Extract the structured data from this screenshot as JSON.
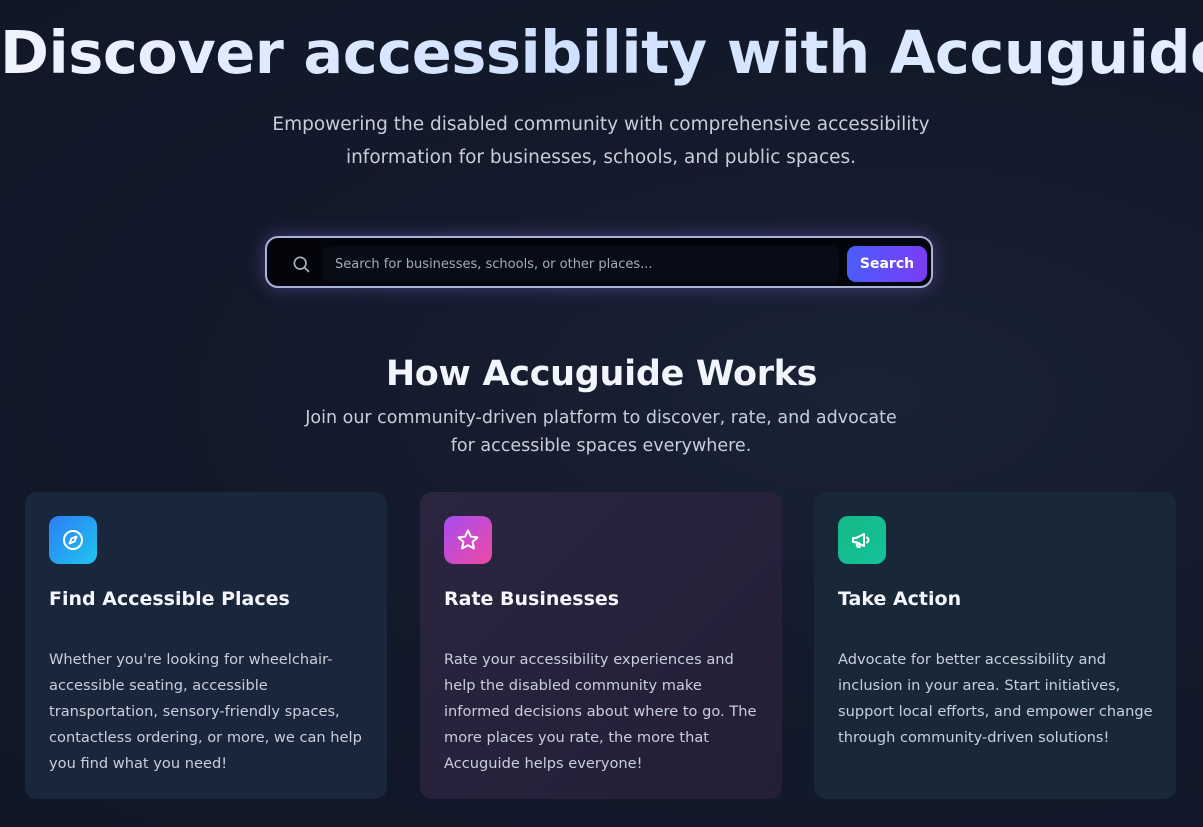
{
  "hero": {
    "title": "Discover accessibility with Accuguide",
    "subtitle": "Empowering the disabled community with comprehensive accessibility information for businesses, schools, and public spaces."
  },
  "search": {
    "placeholder": "Search for businesses, schools, or other places...",
    "value": "",
    "button_label": "Search",
    "icon": "search-icon"
  },
  "how_it_works": {
    "title": "How Accuguide Works",
    "subtitle": "Join our community-driven platform to discover, rate, and advocate for accessible spaces everywhere.",
    "cards": [
      {
        "icon": "compass-icon",
        "title": "Find Accessible Places",
        "text": "Whether you're looking for wheelchair-accessible seating, accessible transportation, sensory-friendly spaces, contactless ordering, or more, we can help you find what you need!"
      },
      {
        "icon": "star-icon",
        "title": "Rate Businesses",
        "text": "Rate your accessibility experiences and help the disabled community make informed decisions about where to go. The more places you rate, the more that Accuguide helps everyone!"
      },
      {
        "icon": "megaphone-icon",
        "title": "Take Action",
        "text": "Advocate for better accessibility and inclusion in your area. Start initiatives, support local efforts, and empower change through community-driven solutions!"
      }
    ]
  },
  "colors": {
    "background": "#131a2b",
    "accent_gradient_start": "#4b5dfb",
    "accent_gradient_end": "#7a3cf6",
    "icon_blue": "#2d7cf6",
    "icon_pink": "#ee4aa3",
    "icon_green": "#16b886"
  }
}
